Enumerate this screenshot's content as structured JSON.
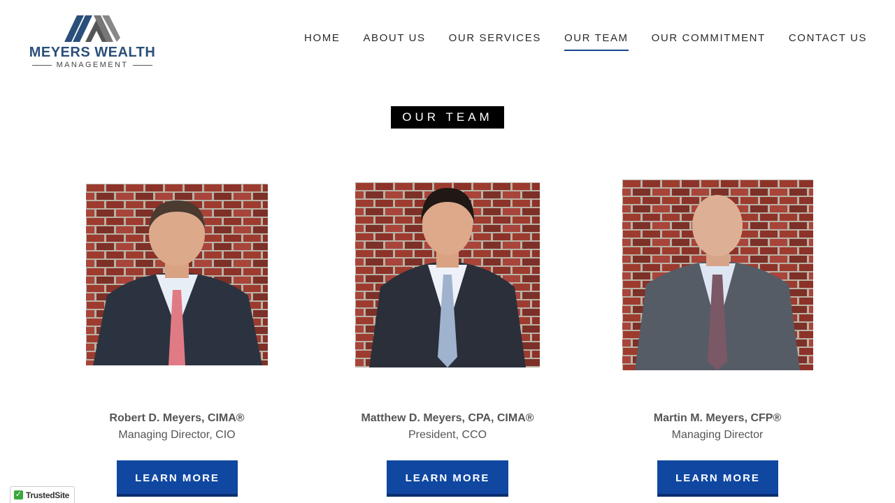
{
  "brand": {
    "name": "MEYERS WEALTH",
    "subtitle": "MANAGEMENT",
    "colors": {
      "primary": "#2a4f7a",
      "accent": "#0f47a1"
    }
  },
  "nav": {
    "items": [
      {
        "label": "HOME",
        "active": false
      },
      {
        "label": "ABOUT US",
        "active": false
      },
      {
        "label": "OUR SERVICES",
        "active": false
      },
      {
        "label": "OUR TEAM",
        "active": true
      },
      {
        "label": "OUR COMMITMENT",
        "active": false
      },
      {
        "label": "CONTACT US",
        "active": false
      }
    ]
  },
  "section": {
    "title": "OUR TEAM"
  },
  "team": [
    {
      "name": "Robert D. Meyers, CIMA®",
      "role": "Managing Director, CIO",
      "button": "LEARN MORE"
    },
    {
      "name": "Matthew D. Meyers, CPA, CIMA®",
      "role": "President, CCO",
      "button": "LEARN MORE"
    },
    {
      "name": "Martin M. Meyers, CFP®",
      "role": "Managing Director",
      "button": "LEARN MORE"
    }
  ],
  "badge": {
    "label": "TrustedSite"
  }
}
